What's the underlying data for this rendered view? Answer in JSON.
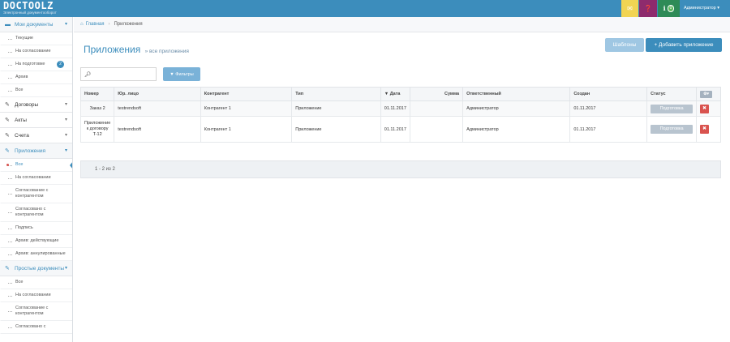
{
  "brand": {
    "logo": "DOCTOOLZ",
    "tagline": "Электронный документооборот"
  },
  "topbar": {
    "mail_icon": "envelope-icon",
    "help_icon": "question-icon",
    "info_icon": "info-icon",
    "info_badge": "0",
    "user": "Администратор"
  },
  "colors": {
    "accent": "#3c8dbc",
    "mail": "#f1d453",
    "help": "#8e2b6d",
    "info": "#2e8b57",
    "danger": "#d9534f"
  },
  "sidebar": {
    "my_docs": {
      "label": "Мои документы",
      "items": [
        "Текущие",
        "На согласование",
        "На подготовке",
        "Архив",
        "Все"
      ],
      "prep_count": "2"
    },
    "contracts": "Договоры",
    "acts": "Акты",
    "invoices": "Счета",
    "apps": {
      "label": "Приложения",
      "items": [
        "Все",
        "На согласовании",
        "Согласование с контрагентом",
        "Согласовано с контрагентом",
        "Подпись",
        "Архив: действующие",
        "Архив: аннулированные"
      ]
    },
    "simple": {
      "label": "Простые документы",
      "items": [
        "Все",
        "На согласовании",
        "Согласование с контрагентом",
        "Согласовано с"
      ]
    }
  },
  "breadcrumb": {
    "home": "Главная",
    "current": "Приложения"
  },
  "page": {
    "title": "Приложения",
    "subtitle": "все приложения",
    "templates_button": "Шаблоны",
    "add_button": "+ Добавить приложение"
  },
  "search": {
    "value": "",
    "placeholder": ""
  },
  "filter_button": "Фильтры",
  "table": {
    "headers": {
      "num": "Номер",
      "legal": "Юр. лицо",
      "contractor": "Контрагент",
      "type": "Тип",
      "date": "▼ Дата",
      "sum": "Сумма",
      "responsible": "Ответственный",
      "created": "Создан",
      "status": "Статус"
    },
    "rows": [
      {
        "num": "Заказ 2",
        "legal": "testrendsoft",
        "contractor": "Контрагент 1",
        "type": "Приложение",
        "date": "01.11.2017",
        "sum": "",
        "responsible": "Администратор",
        "created": "01.11.2017",
        "status": "Подготовка"
      },
      {
        "num": "Приложение к договору T-12",
        "legal": "testrendsoft",
        "contractor": "Контрагент 1",
        "type": "Приложение",
        "date": "01.11.2017",
        "sum": "",
        "responsible": "Администратор",
        "created": "01.11.2017",
        "status": "Подготовка"
      }
    ]
  },
  "pagination": {
    "summary": "1 - 2 из 2"
  }
}
